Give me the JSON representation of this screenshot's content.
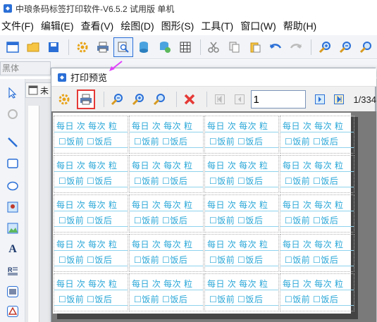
{
  "app": {
    "title": "中琅条码标签打印软件-V6.5.2 试用版 单机"
  },
  "menu": {
    "items": [
      "文件(F)",
      "编辑(E)",
      "查看(V)",
      "绘图(D)",
      "图形(S)",
      "工具(T)",
      "窗口(W)",
      "帮助(H)"
    ]
  },
  "fontbar": {
    "font_name": "黑体"
  },
  "document": {
    "tab_label": "未"
  },
  "preview": {
    "title": "打印预览",
    "current_page": "1",
    "total_pages": "1/334",
    "labels": {
      "line1": "每日 次  每次  粒",
      "line2": "☐饭前  ☐饭后"
    }
  },
  "colors": {
    "label_text": "#2aa7d8",
    "highlight_border": "#e53935",
    "cursor_arrow": "#e040fb"
  }
}
